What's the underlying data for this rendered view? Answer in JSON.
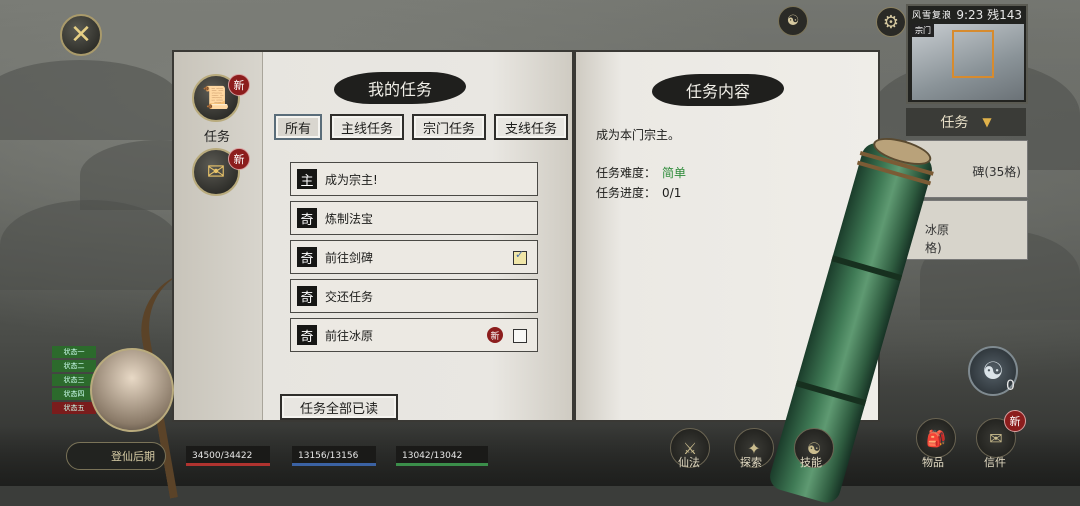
{
  "hud": {
    "close_icon": "✕",
    "minimap_title": "风雪复浪",
    "minimap_time": "9:23 残143",
    "minimap_label": "宗门",
    "quest_tab": "任务",
    "side_card_1": "碑(35格)",
    "side_card_2": "冰原",
    "side_card_3": "格)",
    "realm": "登仙后期",
    "hp": "34500/34422",
    "mp": "13156/13156",
    "sp": "13042/13042",
    "yinyang_count": "0",
    "btn_items": "物品",
    "btn_mail": "信件",
    "btn_3": "仙法",
    "btn_4": "探索",
    "btn_5": "技能",
    "new_badge": "新",
    "status_tags": [
      "状态一",
      "状态二",
      "状态三",
      "状态四",
      "状态五"
    ]
  },
  "left_nav": {
    "quest_label": "任务",
    "new_badge": "新"
  },
  "my_tasks": {
    "title": "我的任务",
    "filters": [
      "所有",
      "主线任务",
      "宗门任务",
      "支线任务"
    ],
    "tasks": [
      {
        "type": "主",
        "name": "成为宗主!",
        "checked": false,
        "is_new": false
      },
      {
        "type": "奇",
        "name": "炼制法宝",
        "checked": false,
        "is_new": false
      },
      {
        "type": "奇",
        "name": "前往剑碑",
        "checked": true,
        "is_new": false
      },
      {
        "type": "奇",
        "name": "交还任务",
        "checked": false,
        "is_new": false
      },
      {
        "type": "奇",
        "name": "前往冰原",
        "checked": false,
        "is_new": true
      }
    ],
    "read_all": "任务全部已读",
    "new_badge": "新"
  },
  "task_detail": {
    "title": "任务内容",
    "description": "成为本门宗主。",
    "difficulty_label": "任务难度：",
    "difficulty_value": "简单",
    "progress_label": "任务进度：",
    "progress_value": "0/1"
  },
  "colors": {
    "difficulty_easy": "#2e8b3a",
    "new_badge": "#8c1d1d",
    "panel_paper": "#e9e7e2"
  }
}
